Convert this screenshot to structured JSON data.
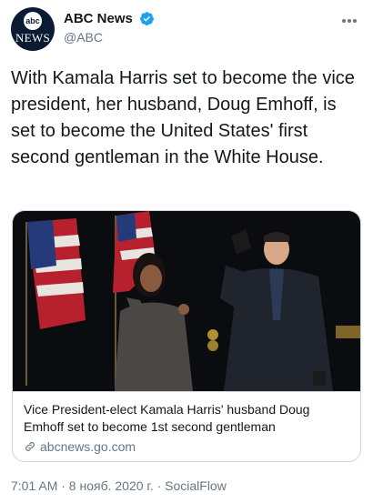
{
  "author": {
    "display_name": "ABC News",
    "handle": "@ABC",
    "avatar_top": "abc",
    "avatar_bottom": "NEWS"
  },
  "tweet": {
    "text": "With Kamala Harris set to become the vice president, her husband, Doug Emhoff, is set to become the United States' first second gentleman in the White House."
  },
  "card": {
    "title": "Vice President-elect Kamala Harris' husband Doug Emhoff set to become 1st second gentleman",
    "domain": "abcnews.go.com"
  },
  "meta": {
    "timestamp": "7:01 AM · 8 нояб. 2020 г. · SocialFlow"
  },
  "icons": {
    "verified": "verified-badge-icon",
    "more": "more-options-icon",
    "link": "link-icon"
  },
  "colors": {
    "text": "#14171a",
    "secondary": "#657786",
    "verified": "#1da1f2",
    "border": "#ccd6dd"
  }
}
